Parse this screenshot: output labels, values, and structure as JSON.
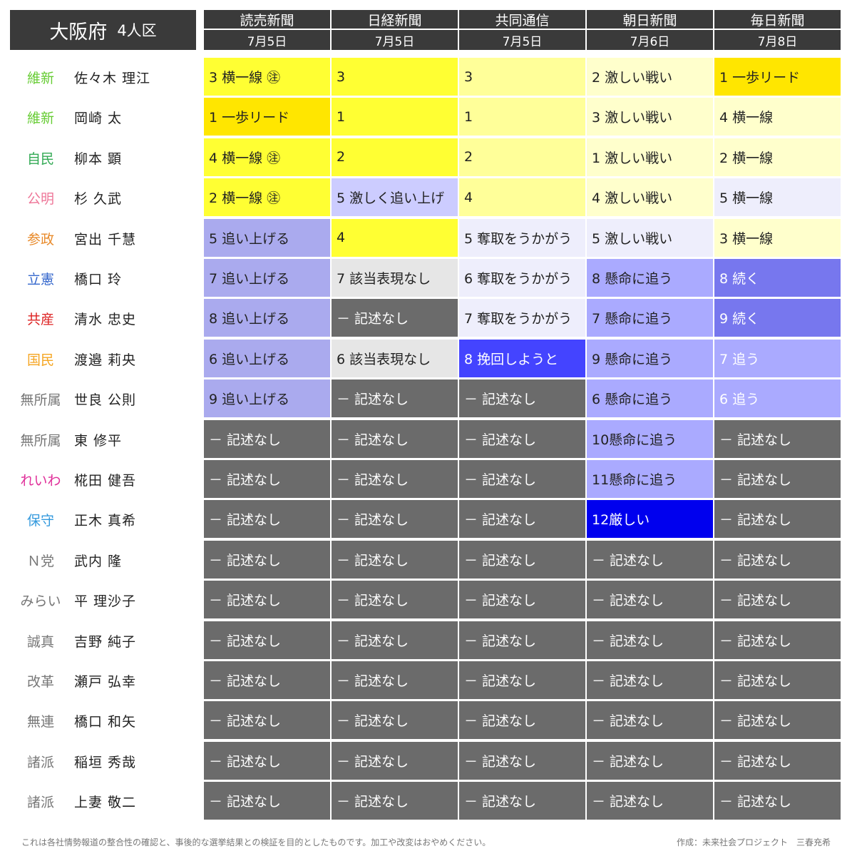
{
  "title": {
    "main": "大阪府",
    "sub": "4人区"
  },
  "columns": [
    {
      "name": "読売新聞",
      "date": "7月5日"
    },
    {
      "name": "日経新聞",
      "date": "7月5日"
    },
    {
      "name": "共同通信",
      "date": "7月5日"
    },
    {
      "name": "朝日新聞",
      "date": "7月6日"
    },
    {
      "name": "毎日新聞",
      "date": "7月8日"
    }
  ],
  "rows": [
    {
      "party": "維新",
      "party_color": "#66cc33",
      "candidate": "佐々木 理江",
      "cells": [
        {
          "text": "3 横一線 ㊟",
          "bg": "#ffff33",
          "fg": "#222222"
        },
        {
          "text": "3",
          "bg": "#ffff33",
          "fg": "#222222"
        },
        {
          "text": "3",
          "bg": "#ffff99",
          "fg": "#222222"
        },
        {
          "text": "2 激しい戦い",
          "bg": "#ffffcc",
          "fg": "#222222"
        },
        {
          "text": "1 一歩リード",
          "bg": "#ffe600",
          "fg": "#222222"
        }
      ]
    },
    {
      "party": "維新",
      "party_color": "#66cc33",
      "candidate": "岡崎 太",
      "cells": [
        {
          "text": "1 一歩リード",
          "bg": "#ffe600",
          "fg": "#222222"
        },
        {
          "text": "1",
          "bg": "#ffff33",
          "fg": "#222222"
        },
        {
          "text": "1",
          "bg": "#ffff99",
          "fg": "#222222"
        },
        {
          "text": "3 激しい戦い",
          "bg": "#ffffcc",
          "fg": "#222222"
        },
        {
          "text": "4 横一線",
          "bg": "#ffffcc",
          "fg": "#222222"
        }
      ]
    },
    {
      "party": "自民",
      "party_color": "#33aa55",
      "candidate": "柳本 顕",
      "cells": [
        {
          "text": "4 横一線 ㊟",
          "bg": "#ffff33",
          "fg": "#222222"
        },
        {
          "text": "2",
          "bg": "#ffff33",
          "fg": "#222222"
        },
        {
          "text": "2",
          "bg": "#ffff99",
          "fg": "#222222"
        },
        {
          "text": "1 激しい戦い",
          "bg": "#ffffcc",
          "fg": "#222222"
        },
        {
          "text": "2 横一線",
          "bg": "#ffffcc",
          "fg": "#222222"
        }
      ]
    },
    {
      "party": "公明",
      "party_color": "#ee7799",
      "candidate": "杉 久武",
      "cells": [
        {
          "text": "2 横一線 ㊟",
          "bg": "#ffff33",
          "fg": "#222222"
        },
        {
          "text": "5 激しく追い上げ",
          "bg": "#ccccff",
          "fg": "#222222"
        },
        {
          "text": "4",
          "bg": "#ffff99",
          "fg": "#222222"
        },
        {
          "text": "4 激しい戦い",
          "bg": "#ffffcc",
          "fg": "#222222"
        },
        {
          "text": "5 横一線",
          "bg": "#eeeefc",
          "fg": "#222222"
        }
      ]
    },
    {
      "party": "参政",
      "party_color": "#e88a2a",
      "candidate": "宮出 千慧",
      "cells": [
        {
          "text": "5 追い上げる",
          "bg": "#aaaaee",
          "fg": "#222222"
        },
        {
          "text": "4",
          "bg": "#ffff33",
          "fg": "#222222"
        },
        {
          "text": "5 奪取をうかがう",
          "bg": "#eeeefc",
          "fg": "#222222"
        },
        {
          "text": "5 激しい戦い",
          "bg": "#eeeefc",
          "fg": "#222222"
        },
        {
          "text": "3 横一線",
          "bg": "#ffffcc",
          "fg": "#222222"
        }
      ]
    },
    {
      "party": "立憲",
      "party_color": "#3366cc",
      "candidate": "橋口 玲",
      "cells": [
        {
          "text": "7 追い上げる",
          "bg": "#aaaaee",
          "fg": "#222222"
        },
        {
          "text": "7 該当表現なし",
          "bg": "#e6e6e6",
          "fg": "#222222"
        },
        {
          "text": "6 奪取をうかがう",
          "bg": "#eeeefc",
          "fg": "#222222"
        },
        {
          "text": "8 懸命に追う",
          "bg": "#aaaaff",
          "fg": "#222222"
        },
        {
          "text": "8 続く",
          "bg": "#7777ee",
          "fg": "#ffffff"
        }
      ]
    },
    {
      "party": "共産",
      "party_color": "#dd2222",
      "candidate": "清水 忠史",
      "cells": [
        {
          "text": "8 追い上げる",
          "bg": "#aaaaee",
          "fg": "#222222"
        },
        {
          "text": "－ 記述なし",
          "bg": "#6b6b6b",
          "fg": "#ffffff"
        },
        {
          "text": "7 奪取をうかがう",
          "bg": "#eeeefc",
          "fg": "#222222"
        },
        {
          "text": "7 懸命に追う",
          "bg": "#aaaaff",
          "fg": "#222222"
        },
        {
          "text": "9 続く",
          "bg": "#7777ee",
          "fg": "#ffffff"
        }
      ]
    },
    {
      "party": "国民",
      "party_color": "#f5a623",
      "candidate": "渡邉 莉央",
      "cells": [
        {
          "text": "6 追い上げる",
          "bg": "#aaaaee",
          "fg": "#222222"
        },
        {
          "text": "6 該当表現なし",
          "bg": "#e6e6e6",
          "fg": "#222222"
        },
        {
          "text": "8 挽回しようと",
          "bg": "#4444ff",
          "fg": "#ffffff"
        },
        {
          "text": "9 懸命に追う",
          "bg": "#aaaaff",
          "fg": "#222222"
        },
        {
          "text": "7 追う",
          "bg": "#aaaaff",
          "fg": "#ffffff"
        }
      ]
    },
    {
      "party": "無所属",
      "party_color": "#777777",
      "candidate": "世良 公則",
      "cells": [
        {
          "text": "9 追い上げる",
          "bg": "#aaaaee",
          "fg": "#222222"
        },
        {
          "text": "－ 記述なし",
          "bg": "#6b6b6b",
          "fg": "#ffffff"
        },
        {
          "text": "－ 記述なし",
          "bg": "#6b6b6b",
          "fg": "#ffffff"
        },
        {
          "text": "6 懸命に追う",
          "bg": "#aaaaff",
          "fg": "#222222"
        },
        {
          "text": "6 追う",
          "bg": "#aaaaff",
          "fg": "#ffffff"
        }
      ]
    },
    {
      "party": "無所属",
      "party_color": "#777777",
      "candidate": "東 修平",
      "cells": [
        {
          "text": "－ 記述なし",
          "bg": "#6b6b6b",
          "fg": "#ffffff"
        },
        {
          "text": "－ 記述なし",
          "bg": "#6b6b6b",
          "fg": "#ffffff"
        },
        {
          "text": "－ 記述なし",
          "bg": "#6b6b6b",
          "fg": "#ffffff"
        },
        {
          "text": "10懸命に追う",
          "bg": "#aaaaff",
          "fg": "#222222"
        },
        {
          "text": "－ 記述なし",
          "bg": "#6b6b6b",
          "fg": "#ffffff"
        }
      ]
    },
    {
      "party": "れいわ",
      "party_color": "#e0309a",
      "candidate": "椛田 健吾",
      "cells": [
        {
          "text": "－ 記述なし",
          "bg": "#6b6b6b",
          "fg": "#ffffff"
        },
        {
          "text": "－ 記述なし",
          "bg": "#6b6b6b",
          "fg": "#ffffff"
        },
        {
          "text": "－ 記述なし",
          "bg": "#6b6b6b",
          "fg": "#ffffff"
        },
        {
          "text": "11懸命に追う",
          "bg": "#aaaaff",
          "fg": "#222222"
        },
        {
          "text": "－ 記述なし",
          "bg": "#6b6b6b",
          "fg": "#ffffff"
        }
      ]
    },
    {
      "party": "保守",
      "party_color": "#3399dd",
      "candidate": "正木 真希",
      "cells": [
        {
          "text": "－ 記述なし",
          "bg": "#6b6b6b",
          "fg": "#ffffff"
        },
        {
          "text": "－ 記述なし",
          "bg": "#6b6b6b",
          "fg": "#ffffff"
        },
        {
          "text": "－ 記述なし",
          "bg": "#6b6b6b",
          "fg": "#ffffff"
        },
        {
          "text": "12厳しい",
          "bg": "#0000ee",
          "fg": "#ffffff"
        },
        {
          "text": "－ 記述なし",
          "bg": "#6b6b6b",
          "fg": "#ffffff"
        }
      ]
    },
    {
      "party": "Ｎ党",
      "party_color": "#777777",
      "candidate": "武内 隆",
      "cells": [
        {
          "text": "－ 記述なし",
          "bg": "#6b6b6b",
          "fg": "#ffffff"
        },
        {
          "text": "－ 記述なし",
          "bg": "#6b6b6b",
          "fg": "#ffffff"
        },
        {
          "text": "－ 記述なし",
          "bg": "#6b6b6b",
          "fg": "#ffffff"
        },
        {
          "text": "－ 記述なし",
          "bg": "#6b6b6b",
          "fg": "#ffffff"
        },
        {
          "text": "－ 記述なし",
          "bg": "#6b6b6b",
          "fg": "#ffffff"
        }
      ]
    },
    {
      "party": "みらい",
      "party_color": "#777777",
      "candidate": "平 理沙子",
      "cells": [
        {
          "text": "－ 記述なし",
          "bg": "#6b6b6b",
          "fg": "#ffffff"
        },
        {
          "text": "－ 記述なし",
          "bg": "#6b6b6b",
          "fg": "#ffffff"
        },
        {
          "text": "－ 記述なし",
          "bg": "#6b6b6b",
          "fg": "#ffffff"
        },
        {
          "text": "－ 記述なし",
          "bg": "#6b6b6b",
          "fg": "#ffffff"
        },
        {
          "text": "－ 記述なし",
          "bg": "#6b6b6b",
          "fg": "#ffffff"
        }
      ]
    },
    {
      "party": "誠真",
      "party_color": "#777777",
      "candidate": "吉野 純子",
      "cells": [
        {
          "text": "－ 記述なし",
          "bg": "#6b6b6b",
          "fg": "#ffffff"
        },
        {
          "text": "－ 記述なし",
          "bg": "#6b6b6b",
          "fg": "#ffffff"
        },
        {
          "text": "－ 記述なし",
          "bg": "#6b6b6b",
          "fg": "#ffffff"
        },
        {
          "text": "－ 記述なし",
          "bg": "#6b6b6b",
          "fg": "#ffffff"
        },
        {
          "text": "－ 記述なし",
          "bg": "#6b6b6b",
          "fg": "#ffffff"
        }
      ]
    },
    {
      "party": "改革",
      "party_color": "#777777",
      "candidate": "瀬戸 弘幸",
      "cells": [
        {
          "text": "－ 記述なし",
          "bg": "#6b6b6b",
          "fg": "#ffffff"
        },
        {
          "text": "－ 記述なし",
          "bg": "#6b6b6b",
          "fg": "#ffffff"
        },
        {
          "text": "－ 記述なし",
          "bg": "#6b6b6b",
          "fg": "#ffffff"
        },
        {
          "text": "－ 記述なし",
          "bg": "#6b6b6b",
          "fg": "#ffffff"
        },
        {
          "text": "－ 記述なし",
          "bg": "#6b6b6b",
          "fg": "#ffffff"
        }
      ]
    },
    {
      "party": "無連",
      "party_color": "#777777",
      "candidate": "橋口 和矢",
      "cells": [
        {
          "text": "－ 記述なし",
          "bg": "#6b6b6b",
          "fg": "#ffffff"
        },
        {
          "text": "－ 記述なし",
          "bg": "#6b6b6b",
          "fg": "#ffffff"
        },
        {
          "text": "－ 記述なし",
          "bg": "#6b6b6b",
          "fg": "#ffffff"
        },
        {
          "text": "－ 記述なし",
          "bg": "#6b6b6b",
          "fg": "#ffffff"
        },
        {
          "text": "－ 記述なし",
          "bg": "#6b6b6b",
          "fg": "#ffffff"
        }
      ]
    },
    {
      "party": "諸派",
      "party_color": "#777777",
      "candidate": "稲垣 秀哉",
      "cells": [
        {
          "text": "－ 記述なし",
          "bg": "#6b6b6b",
          "fg": "#ffffff"
        },
        {
          "text": "－ 記述なし",
          "bg": "#6b6b6b",
          "fg": "#ffffff"
        },
        {
          "text": "－ 記述なし",
          "bg": "#6b6b6b",
          "fg": "#ffffff"
        },
        {
          "text": "－ 記述なし",
          "bg": "#6b6b6b",
          "fg": "#ffffff"
        },
        {
          "text": "－ 記述なし",
          "bg": "#6b6b6b",
          "fg": "#ffffff"
        }
      ]
    },
    {
      "party": "諸派",
      "party_color": "#777777",
      "candidate": "上妻 敬二",
      "cells": [
        {
          "text": "－ 記述なし",
          "bg": "#6b6b6b",
          "fg": "#ffffff"
        },
        {
          "text": "－ 記述なし",
          "bg": "#6b6b6b",
          "fg": "#ffffff"
        },
        {
          "text": "－ 記述なし",
          "bg": "#6b6b6b",
          "fg": "#ffffff"
        },
        {
          "text": "－ 記述なし",
          "bg": "#6b6b6b",
          "fg": "#ffffff"
        },
        {
          "text": "－ 記述なし",
          "bg": "#6b6b6b",
          "fg": "#ffffff"
        }
      ]
    }
  ],
  "footer": {
    "note": "これは各社情勢報道の整合性の確認と、事後的な選挙結果との検証を目的としたものです。加工や改変はおやめください。",
    "credit": "作成：未来社会プロジェクト　三春充希"
  }
}
